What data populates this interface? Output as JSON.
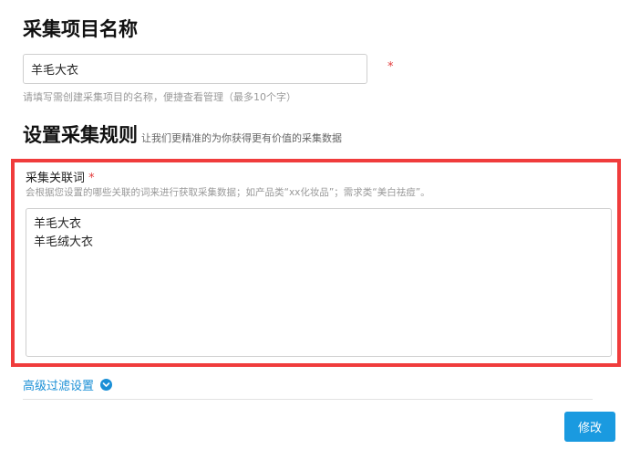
{
  "project_name": {
    "title": "采集项目名称",
    "value": "羊毛大衣",
    "required_mark": "*",
    "hint": "请填写需创建采集项目的名称，便捷查看管理（最多10个字）"
  },
  "rules": {
    "title": "设置采集规则",
    "subtitle": "让我们更精准的为你获得更有价值的采集数据"
  },
  "keywords": {
    "label": "采集关联词",
    "required_mark": "*",
    "hint": "会根据您设置的哪些关联的词来进行获取采集数据；如产品类“xx化妆品”；需求类“美白祛痘”。",
    "lines": [
      "羊毛大衣",
      "羊毛绒大衣"
    ]
  },
  "advanced": {
    "link_label": "高级过滤设置",
    "icon": "chevron-down-icon"
  },
  "actions": {
    "submit_label": "修改"
  },
  "colors": {
    "accent": "#1a9ae0",
    "highlight_border": "#f03c3c",
    "required": "#e23b3b"
  }
}
